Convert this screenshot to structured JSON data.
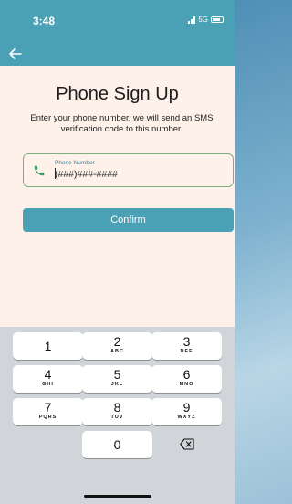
{
  "status": {
    "time": "3:48",
    "network": "5G"
  },
  "page": {
    "title": "Phone Sign Up",
    "subtitle": "Enter your phone number, we will send an SMS verification code to this number."
  },
  "phone_field": {
    "label": "Phone Number",
    "placeholder": "(###)###-####"
  },
  "confirm_button": {
    "label": "Confirm"
  },
  "keypad": {
    "keys": [
      {
        "num": "1",
        "letters": ""
      },
      {
        "num": "2",
        "letters": "ABC"
      },
      {
        "num": "3",
        "letters": "DEF"
      },
      {
        "num": "4",
        "letters": "GHI"
      },
      {
        "num": "5",
        "letters": "JKL"
      },
      {
        "num": "6",
        "letters": "MNO"
      },
      {
        "num": "7",
        "letters": "PQRS"
      },
      {
        "num": "8",
        "letters": "TUV"
      },
      {
        "num": "9",
        "letters": "WXYZ"
      },
      {
        "num": "0",
        "letters": ""
      }
    ]
  },
  "icons": {
    "back": "arrow-left-icon",
    "phone": "phone-icon",
    "delete": "backspace-icon"
  },
  "colors": {
    "accent": "#4aa0b5",
    "field_border": "#7fae80",
    "background": "#fdf1ea"
  }
}
